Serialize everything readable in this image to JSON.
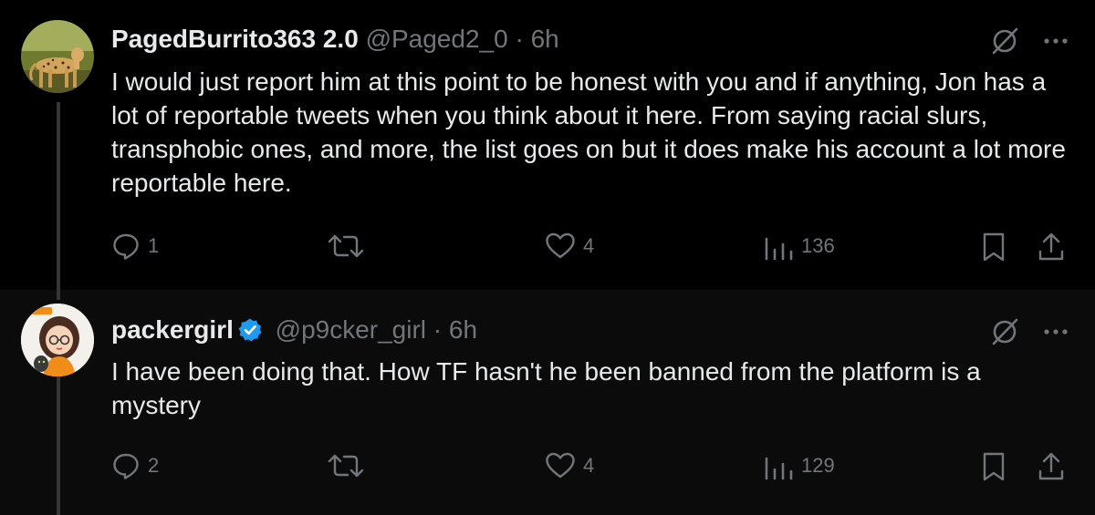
{
  "tweets": [
    {
      "display_name": "PagedBurrito363 2.0",
      "handle": "@Paged2_0",
      "separator": "·",
      "time": "6h",
      "verified": false,
      "text": "I would just report him at this point to be honest with you and if anything, Jon has a lot of reportable tweets when you think about it here. From saying racial slurs, transphobic ones, and more, the list goes on but it does make his account a lot more reportable here.",
      "replies": "1",
      "reposts": "",
      "likes": "4",
      "views": "136"
    },
    {
      "display_name": "packergirl",
      "handle": "@p9cker_girl",
      "separator": "·",
      "time": "6h",
      "verified": true,
      "text": "I have been doing that. How TF hasn't he been banned from the platform is a mystery",
      "replies": "2",
      "reposts": "",
      "likes": "4",
      "views": "129"
    }
  ],
  "icons": {
    "grok": "grok-icon",
    "more": "more-icon",
    "reply": "reply-icon",
    "repost": "repost-icon",
    "like": "heart-icon",
    "views": "views-icon",
    "bookmark": "bookmark-icon",
    "share": "share-icon",
    "verified": "verified-badge-icon"
  },
  "colors": {
    "background": "#000000",
    "background_alt": "#0b0b0b",
    "text_primary": "#e7e9ea",
    "text_secondary": "#71767b",
    "verified_blue": "#1d9bf0",
    "thread_line": "#333639"
  }
}
